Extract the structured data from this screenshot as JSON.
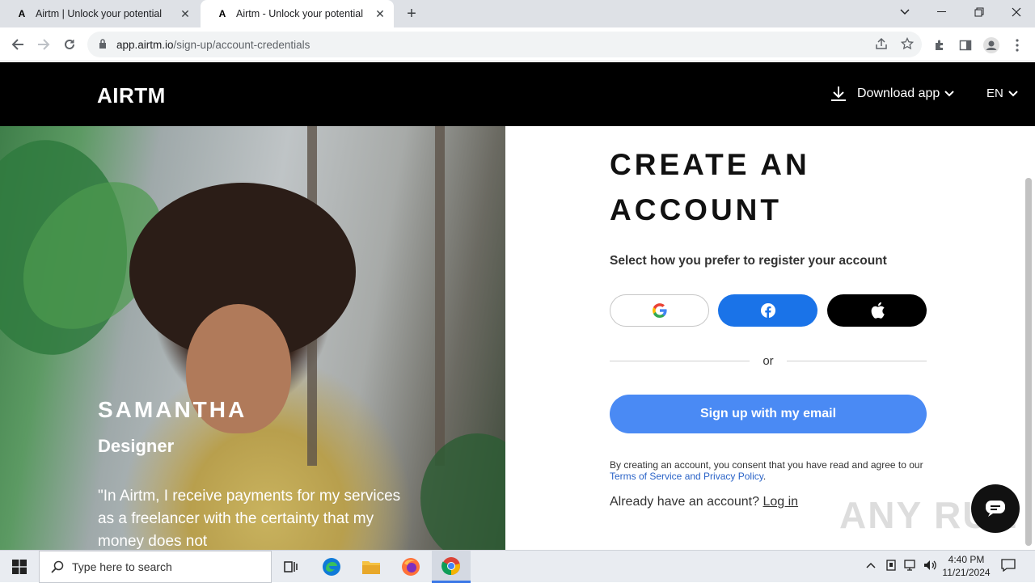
{
  "browser": {
    "tabs": [
      {
        "title": "Airtm | Unlock your potential",
        "active": false
      },
      {
        "title": "Airtm - Unlock your potential",
        "active": true
      }
    ],
    "url_host": "app.airtm.io",
    "url_path": "/sign-up/account-credentials"
  },
  "header": {
    "logo": "AIRTM",
    "download_label": "Download app",
    "language": "EN"
  },
  "hero": {
    "name": "SAMANTHA",
    "role": "Designer",
    "quote": "\"In Airtm, I receive payments for my services as a freelancer with the certainty that my money does not"
  },
  "form": {
    "heading": "CREATE AN ACCOUNT",
    "subheading": "Select how you prefer to register your account",
    "divider_text": "or",
    "email_button": "Sign up with my email",
    "consent_text": "By creating an account, you consent that you have read and agree to our ",
    "consent_link": "Terms of Service and Privacy Policy",
    "consent_end": ".",
    "already_text": "Already have an account?",
    "login_link": "Log in"
  },
  "watermark": "ANY RUN",
  "taskbar": {
    "search_placeholder": "Type here to search",
    "time": "4:40 PM",
    "date": "11/21/2024"
  },
  "colors": {
    "facebook": "#1a73e8",
    "email_button": "#4a8af4",
    "header_bg": "#000000"
  }
}
